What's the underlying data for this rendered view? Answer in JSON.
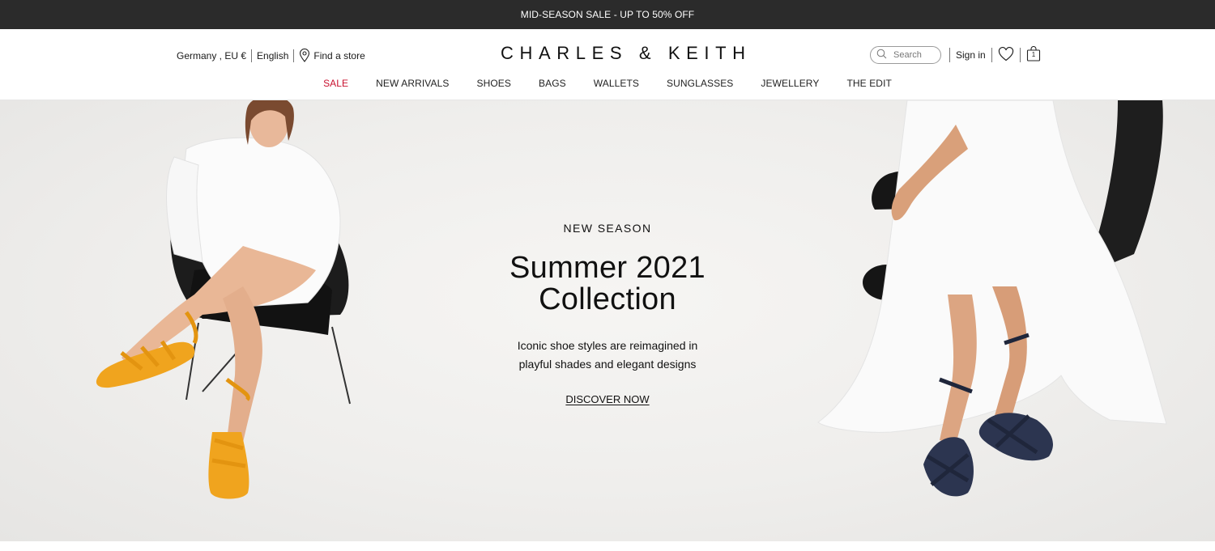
{
  "promo": {
    "text": "MID-SEASON SALE - UP TO 50% OFF"
  },
  "header": {
    "region": "Germany , EU €",
    "language": "English",
    "find_store": "Find a store",
    "logo": "CHARLES & KEITH",
    "search_placeholder": "Search",
    "sign_in": "Sign in",
    "cart_count": "1"
  },
  "nav": {
    "items": [
      "SALE",
      "NEW ARRIVALS",
      "SHOES",
      "BAGS",
      "WALLETS",
      "SUNGLASSES",
      "JEWELLERY",
      "THE EDIT"
    ]
  },
  "hero": {
    "eyebrow": "NEW SEASON",
    "title_line1": "Summer 2021",
    "title_line2": "Collection",
    "desc_line1": "Iconic shoe styles are reimagined in",
    "desc_line2": "playful shades and elegant designs",
    "cta": "DISCOVER NOW"
  },
  "colors": {
    "promo_bg": "#2b2b2b",
    "sale_red": "#c8102e",
    "hero_bg": "#efeeec",
    "sandal_orange": "#f0a41e",
    "sandal_navy": "#2c3550"
  },
  "icons": [
    "location-pin-icon",
    "search-icon",
    "heart-icon",
    "shopping-bag-icon"
  ]
}
